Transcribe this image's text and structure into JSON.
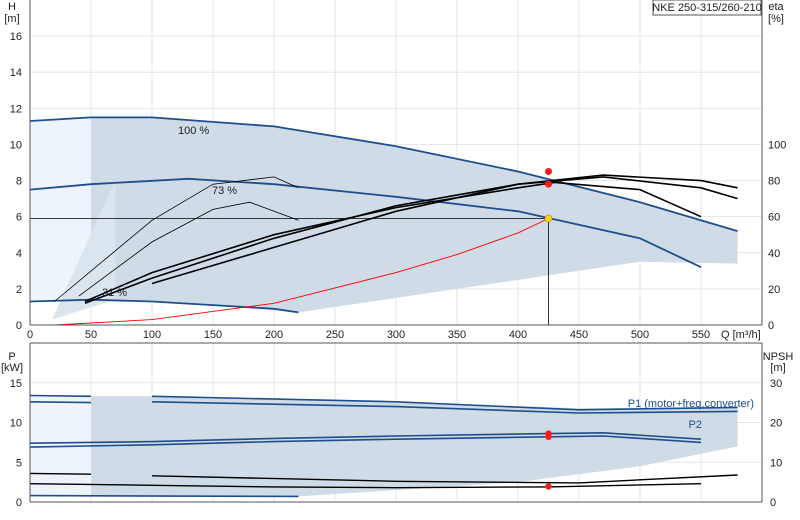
{
  "chart_data": [
    {
      "type": "line",
      "title_box": "NKE 250-315/260-210",
      "ylabel_left": [
        "H",
        "[m]"
      ],
      "ylabel_right": [
        "eta",
        "[%]"
      ],
      "xlabel": "Q [m³/h]",
      "xlim": [
        0,
        600
      ],
      "ylim_left": [
        0,
        18
      ],
      "ylim_right": [
        0,
        180
      ],
      "xticks": [
        0,
        50,
        100,
        150,
        200,
        250,
        300,
        350,
        400,
        450,
        500,
        550
      ],
      "yticks_left": [
        0,
        2,
        4,
        6,
        8,
        10,
        12,
        14,
        16
      ],
      "yticks_right": [
        0,
        20,
        40,
        60,
        80,
        100
      ],
      "speed_labels": [
        "100 %",
        "73 %",
        "31 %"
      ],
      "operating_point": {
        "q": 425,
        "h": 5.9
      },
      "series": [
        {
          "color": "#1f4e8c",
          "x": [
            0,
            50,
            100,
            200,
            300,
            400,
            500,
            580
          ],
          "values": [
            11.3,
            11.5,
            11.5,
            11.0,
            9.9,
            8.5,
            6.8,
            5.2
          ]
        },
        {
          "color": "#1f4e8c",
          "x": [
            0,
            50,
            130,
            200,
            300,
            400,
            500,
            550
          ],
          "values": [
            7.5,
            7.8,
            8.1,
            7.8,
            7.1,
            6.3,
            4.8,
            3.2
          ]
        },
        {
          "color": "#1f4e8c",
          "x": [
            0,
            50,
            100,
            150,
            200,
            220
          ],
          "values": [
            1.3,
            1.4,
            1.3,
            1.1,
            0.9,
            0.7
          ]
        },
        {
          "color": "#ff0000",
          "x": [
            20,
            100,
            200,
            300,
            350,
            400,
            425
          ],
          "values": [
            0,
            0.3,
            1.2,
            2.9,
            3.9,
            5.1,
            5.9
          ]
        },
        {
          "color": "#000000",
          "x": [
            45,
            100,
            200,
            300,
            400,
            430,
            500,
            550
          ],
          "values": [
            1.3,
            2.9,
            5.0,
            6.5,
            7.6,
            7.9,
            7.5,
            6.0
          ]
        },
        {
          "color": "#000000",
          "x": [
            45,
            100,
            200,
            300,
            400,
            470,
            550,
            580
          ],
          "values": [
            1.2,
            2.6,
            4.8,
            6.6,
            7.8,
            8.2,
            7.6,
            7.0
          ]
        },
        {
          "color": "#000000",
          "x": [
            100,
            200,
            300,
            400,
            470,
            550,
            580
          ],
          "values": [
            2.3,
            4.3,
            6.3,
            7.8,
            8.3,
            8.0,
            7.6
          ]
        },
        {
          "color": "#000000",
          "x": [
            40,
            100,
            150,
            180,
            220
          ],
          "values": [
            1.6,
            4.6,
            6.4,
            6.8,
            5.8
          ]
        },
        {
          "color": "#000000",
          "x": [
            20,
            100,
            150,
            200,
            220
          ],
          "values": [
            1.3,
            5.8,
            7.8,
            8.2,
            7.6
          ]
        }
      ]
    },
    {
      "type": "line",
      "ylabel_left": [
        "P",
        "[kW]"
      ],
      "ylabel_right": [
        "NPSH",
        "[m]"
      ],
      "xlim": [
        0,
        600
      ],
      "ylim_left": [
        0,
        20
      ],
      "ylim_right": [
        0,
        40
      ],
      "yticks_left": [
        0,
        5,
        10,
        15
      ],
      "yticks_right": [
        0,
        10,
        20,
        30
      ],
      "legend_labels": [
        "P1 (motor+freq.converter)",
        "P2"
      ],
      "operating_point": {
        "q": 425,
        "p1": 8.6,
        "p2": 8.2,
        "npsh": 3.9
      },
      "series": [
        {
          "color": "#1f4e8c",
          "x": [
            0,
            50
          ],
          "values": [
            13.4,
            13.3
          ]
        },
        {
          "color": "#1f4e8c",
          "x": [
            0,
            50
          ],
          "values": [
            12.6,
            12.5
          ]
        },
        {
          "color": "#1f4e8c",
          "x": [
            100,
            300,
            450,
            580
          ],
          "values": [
            13.3,
            12.6,
            11.6,
            11.9
          ]
        },
        {
          "color": "#1f4e8c",
          "x": [
            100,
            300,
            450,
            580
          ],
          "values": [
            12.6,
            12.0,
            11.2,
            11.4
          ]
        },
        {
          "color": "#1f4e8c",
          "x": [
            0,
            100,
            200,
            300,
            425,
            470,
            550
          ],
          "values": [
            7.4,
            7.6,
            8.0,
            8.3,
            8.6,
            8.7,
            7.9
          ]
        },
        {
          "color": "#1f4e8c",
          "x": [
            0,
            100,
            200,
            300,
            425,
            470,
            550
          ],
          "values": [
            6.9,
            7.2,
            7.6,
            7.9,
            8.2,
            8.3,
            7.5
          ]
        },
        {
          "color": "#1f4e8c",
          "x": [
            0,
            220
          ],
          "values": [
            0.8,
            0.7
          ]
        },
        {
          "color": "#000000",
          "x": [
            0,
            100,
            200,
            300,
            425,
            550
          ],
          "values": [
            2.3,
            2.1,
            1.9,
            1.8,
            1.9,
            2.3
          ]
        },
        {
          "color": "#000000",
          "x": [
            0,
            50
          ],
          "values": [
            3.6,
            3.5
          ]
        },
        {
          "color": "#000000",
          "x": [
            100,
            300,
            450,
            580
          ],
          "values": [
            3.3,
            2.6,
            2.4,
            3.4
          ]
        }
      ]
    }
  ]
}
